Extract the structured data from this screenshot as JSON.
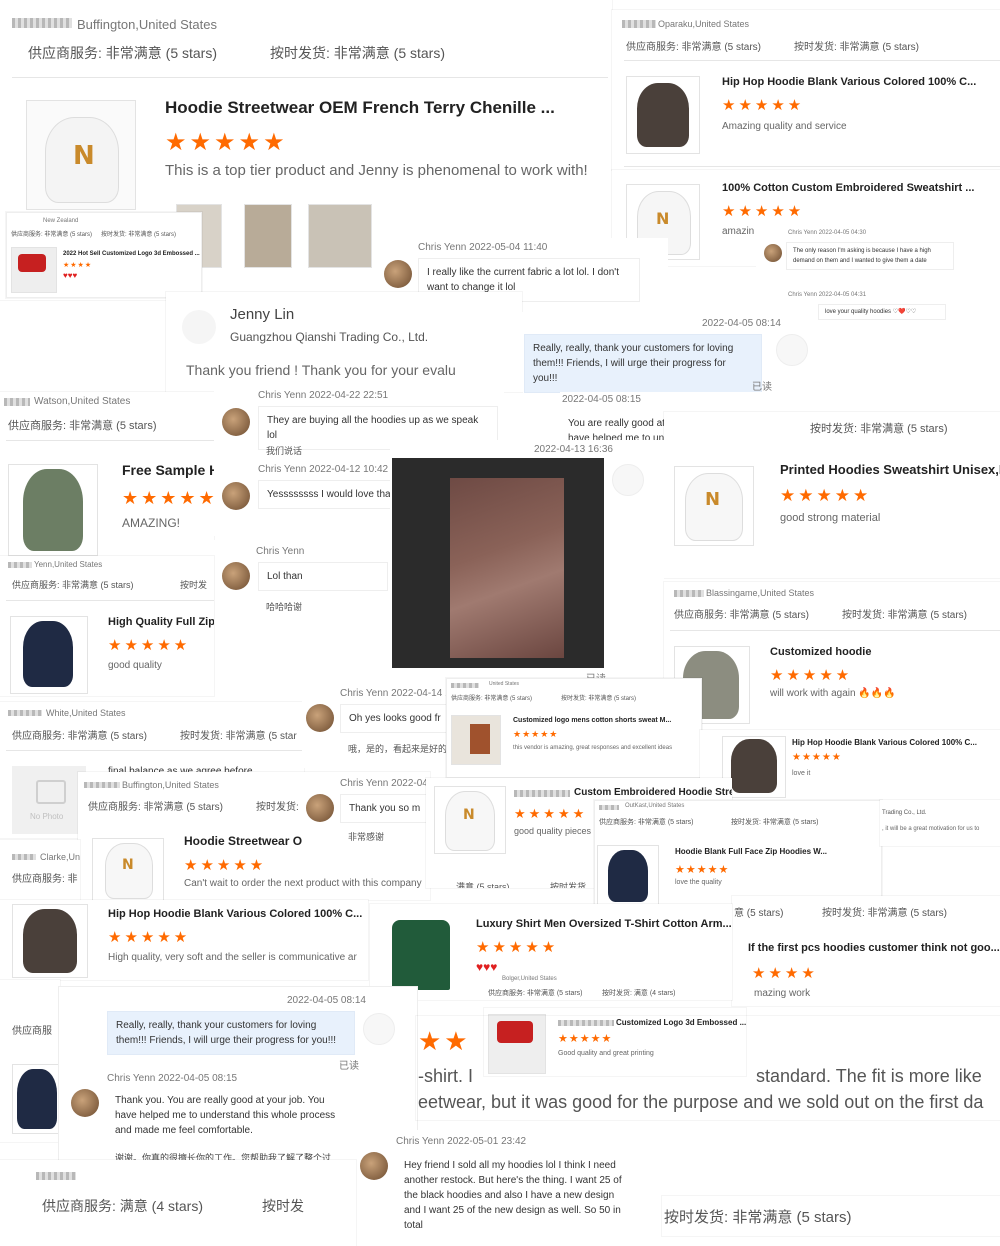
{
  "r1": {
    "location": "Buffington,United States",
    "svc": "供应商服务: 非常满意  (5 stars)",
    "ship": "按时发货: 非常满意  (5 stars)",
    "title": "Hoodie Streetwear OEM French Terry Chenille ...",
    "stars": "★★★★★",
    "comment": "This is a top tier product and Jenny is phenomenal to work with!"
  },
  "r2": {
    "location": "Oparaku,United States",
    "svc": "供应商服务: 非常满意  (5 stars)",
    "ship": "按时发货: 非常满意  (5 stars)",
    "title": "Hip Hop Hoodie Blank Various Colored 100% C...",
    "stars": "★★★★★",
    "comment": "Amazing quality and service"
  },
  "r3": {
    "title": "100% Cotton Custom Embroidered Sweatshirt ...",
    "stars": "★★★★★",
    "comment": "amazin"
  },
  "r4": {
    "location": "New Zealand",
    "svc": "供应商服务: 非常满意  (5 stars)",
    "ship": "按时发货: 非常满意  (5 stars)",
    "title": "2022 Hot Sell Customized Logo 3d Embossed ...",
    "stars": "★★★★",
    "hearts": "♥♥♥"
  },
  "chat1": {
    "meta": "Chris Yenn   2022-05-04 11:40",
    "text": "I really like the current fabric a lot lol. I don't want to change it lol"
  },
  "chat2": {
    "meta": "Chris Yenn   2022-04-05 04:30",
    "text": "The only reason I'm asking is because I have a high demand on them and I wanted to give them a date",
    "meta2": "Chris Yenn   2022-04-05 04:31",
    "text2": "love your quality hoodies ♡❤️♡♡"
  },
  "jenny": {
    "name": "Jenny Lin",
    "company": "Guangzhou Qianshi Trading Co., Ltd.",
    "text": "Thank you friend ! Thank you for your evalu"
  },
  "chat3": {
    "time": "2022-04-05 08:14",
    "text": "Really, really, thank your customers for loving them!!! Friends, I will urge their progress for you!!!",
    "read": "已读"
  },
  "chat3b": {
    "meta": "2022-04-05 08:15",
    "text": "You are really good at your job. You have helped me to understand this whole process"
  },
  "r5": {
    "location": "Watson,United States",
    "svc": "供应商服务: 非常满意  (5 stars)",
    "ship": "按时发货: 非常满意  (5 stars)",
    "title": "Free Sample H",
    "stars": "★★★★★",
    "comment": "AMAZING!"
  },
  "chat4": {
    "meta": "Chris Yenn   2022-04-22 22:51",
    "text": "They are buying all the hoodies up as we speak lol",
    "cn": "我们说话"
  },
  "chat5": {
    "meta": "Chris Yenn   2022-04-12 10:42",
    "text": "Yessssssss I would love that so much"
  },
  "chat6": {
    "meta": "Chris Yenn",
    "text": "Lol than",
    "cn": "哈哈哈谢"
  },
  "video": {
    "time": "2022-04-13 16:36",
    "read": "已读"
  },
  "r6": {
    "title": "Printed Hoodies Sweatshirt Unisex,M",
    "stars": "★★★★★",
    "comment": "good strong material"
  },
  "r7": {
    "location": "Blassingame,United States",
    "svc": "供应商服务: 非常满意  (5 stars)",
    "ship": "按时发货: 非常满意  (5 stars)",
    "title": "Customized hoodie",
    "stars": "★★★★★",
    "comment": "will work with again 🔥🔥🔥"
  },
  "r8": {
    "location": "Yenn,United States",
    "svc": "供应商服务: 非常满意  (5 stars)",
    "ship": "按时发",
    "title": "High Quality Full Zip",
    "stars": "★★★★★",
    "comment": "good quality"
  },
  "r9": {
    "location": "White,United States",
    "svc": "供应商服务: 非常满意  (5 stars)",
    "ship": "按时发货: 非常满意  (5 star",
    "comment": "final balance as we agree before",
    "photo": "No Photo"
  },
  "chat7": {
    "meta": "Chris Yenn   2022-04-14 10",
    "text": "Oh yes looks good fr",
    "cn": "哦，是的，看起来是好的"
  },
  "r10": {
    "location": "United States",
    "svc": "供应商服务: 非常满意  (5 stars)",
    "ship": "按时发货: 非常满意  (5 stars)",
    "title": "Customized logo mens cotton shorts sweat M...",
    "stars": "★★★★★",
    "comment": "this vendor is amazing, great responses and excellent ideas"
  },
  "r11": {
    "title": "Hip Hop Hoodie Blank Various Colored 100% C...",
    "stars": "★★★★★",
    "comment": "love it"
  },
  "r12": {
    "location": "Buffington,United States",
    "svc": "供应商服务: 非常满意  (5 stars)",
    "ship": "按时发货:",
    "title": "Hoodie Streetwear OEI",
    "stars": "★★★★★",
    "comment": "Can't wait to order the next product with this company"
  },
  "chat8": {
    "meta": "Chris Yenn   2022-04",
    "text": "Thank you so m",
    "cn": "非常感谢"
  },
  "r13": {
    "title": "Custom Embroidered Hoodie Stre...",
    "stars": "★★★★★",
    "comment": "good quality pieces",
    "ship": "满意  (5 stars)",
    "ship2": "按时发货"
  },
  "r14": {
    "location": "OutKast,United States",
    "svc": "供应商服务: 非常满意  (5 stars)",
    "ship": "按时发货: 非常满意  (5 stars)",
    "title": "Hoodie Blank Full Face Zip Hoodies W...",
    "stars": "★★★★★",
    "comment": "love the quality"
  },
  "r15": {
    "location": "Clarke,Un",
    "svc": "供应商服务: 非"
  },
  "r16": {
    "title": "Hip Hop Hoodie Blank Various Colored 100% C...",
    "stars": "★★★★★",
    "comment": "High quality, very soft and the seller is communicative ar"
  },
  "r17": {
    "company": "Trading Co., Ltd.",
    "text": ", it will be a great motivation for us to"
  },
  "r18": {
    "svc": "意  (5 stars)",
    "ship": "按时发货: 非常满意  (5 stars)",
    "title": "If the first pcs hoodies customer think not goo...",
    "stars": "★★★★",
    "comment": "mazing work"
  },
  "r19": {
    "title": "Luxury Shirt Men Oversized T-Shirt Cotton Arm...",
    "stars": "★★★★★",
    "hearts": "♥♥♥",
    "location": "Bolger,United States",
    "svc": "供应商服务: 非常满意  (5 stars)",
    "ship": "按时发货: 满意  (4 stars)"
  },
  "r20": {
    "title": "Customized Logo 3d Embossed ...",
    "stars": "★★★★★",
    "comment": "Good quality and great printing"
  },
  "chat9": {
    "time": "2022-04-05 08:14",
    "text": "Really, really, thank your customers for loving them!!! Friends, I will urge their progress for you!!!",
    "read": "已读",
    "meta": "Chris Yenn   2022-04-05 08:15",
    "text2": "Thank you. You are really good at your job. You have helped me to understand this whole process and made me feel comfortable.",
    "cn": "谢谢。你真的很擅长你的工作。您帮助我了解了整个过程，并使我感到舒适。"
  },
  "big": {
    "stars": "★★",
    "line1": "-shirt. I",
    "line1b": "standard. The fit is more like",
    "line2": "eetwear, but it was good for the purpose and we sold out on the first da"
  },
  "chat10": {
    "meta": "Chris Yenn   2022-05-01 23:42",
    "text": "Hey friend I sold all my hoodies lol I think I need another restock. But here's the thing. I want 25 of the black hoodies and also I have a new design and I want 25 of the new design as well. So 50 in total"
  },
  "bottom": {
    "svc": "供应商服务: 满意  (4 stars)",
    "ship": "按时发",
    "ship2": "按时发货: 非常满意  (5 stars)"
  },
  "r21": {
    "svc": "供应商服"
  }
}
